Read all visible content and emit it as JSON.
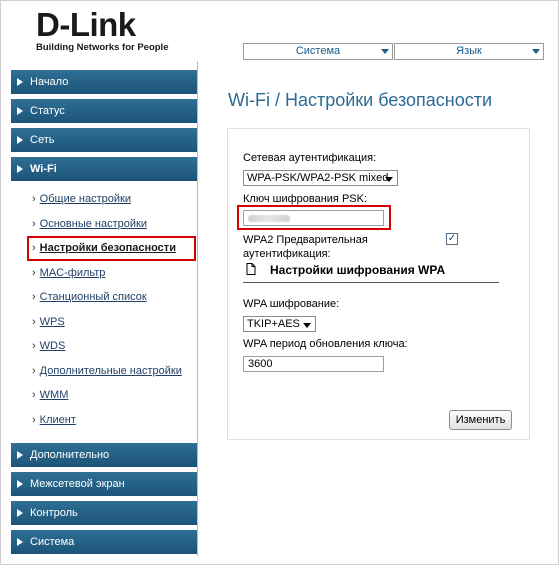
{
  "logo": {
    "brand": "D-Link",
    "tagline": "Building Networks for People"
  },
  "topmenu": {
    "system_label": "Система",
    "language_label": "Язык"
  },
  "nav": {
    "items_top": [
      {
        "label": "Начало"
      },
      {
        "label": "Статус"
      },
      {
        "label": "Сеть"
      },
      {
        "label": "Wi-Fi"
      }
    ],
    "wifi_sub": [
      {
        "label": "Общие настройки"
      },
      {
        "label": "Основные настройки"
      },
      {
        "label": "Настройки безопасности"
      },
      {
        "label": "MAC-фильтр"
      },
      {
        "label": "Станционный список"
      },
      {
        "label": "WPS"
      },
      {
        "label": "WDS"
      },
      {
        "label": "Дополнительные настройки"
      },
      {
        "label": "WMM"
      },
      {
        "label": "Клиент"
      }
    ],
    "items_bottom": [
      {
        "label": "Дополнительно"
      },
      {
        "label": "Межсетевой экран"
      },
      {
        "label": "Контроль"
      },
      {
        "label": "Система"
      }
    ],
    "selected_sub": "Настройки безопасности"
  },
  "page": {
    "title": "Wi-Fi  / Настройки безопасности"
  },
  "form": {
    "auth_label": "Сетевая аутентификация:",
    "auth_value": "WPA-PSK/WPA2-PSK mixed",
    "psk_label": "Ключ шифрования PSK:",
    "psk_value": "",
    "wpa2_preauth_label_line1": "WPA2 Предварительная",
    "wpa2_preauth_label_line2": "аутентификация:",
    "wpa2_preauth_checked": true,
    "section_title": "Настройки шифрования WPA",
    "wpa_cipher_label": "WPA шифрование:",
    "wpa_cipher_value": "TKIP+AES",
    "wpa_rekey_label": "WPA период обновления ключа:",
    "wpa_rekey_value": "3600",
    "apply_label": "Изменить"
  },
  "colors": {
    "nav_bg": "#1c5478",
    "accent_title": "#2c6b94",
    "highlight": "#d60000"
  }
}
